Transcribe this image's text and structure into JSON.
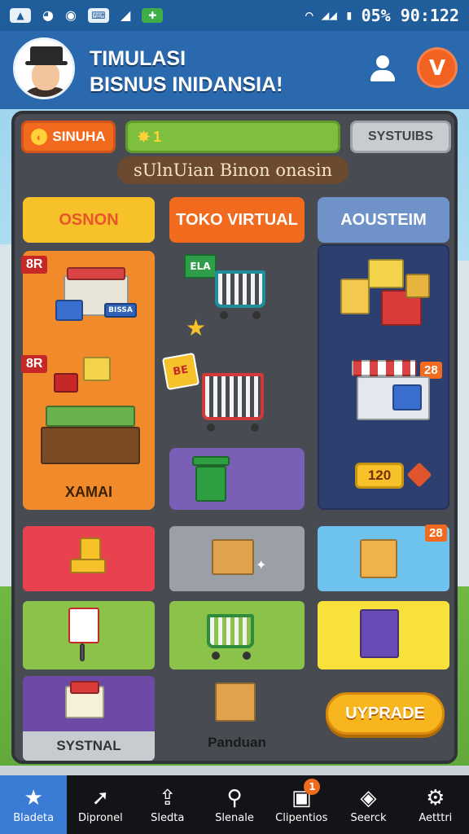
{
  "status_bar": {
    "left_icons": [
      "sim-icon",
      "chrome-icon",
      "whatsapp-icon",
      "keyboard-icon",
      "signal-icon",
      "cast-icon"
    ],
    "right_text": "05% 90:122",
    "battery_icon": "battery-icon",
    "wifi_icon": "wifi-icon"
  },
  "header": {
    "title_line1": "TIMULASI",
    "title_line2": "BISNUS INIDANSIA!",
    "profile_icon": "user-icon",
    "v_button_label": "V"
  },
  "toolbar": {
    "simula_label": "SINUHA",
    "progress_icon": "star-icon",
    "progress_value": "1",
    "systems_label": "SYSTUIBS"
  },
  "banner": "sUlnUian Binon onasin",
  "columns": {
    "left": "OSNON",
    "middle": "TOKO VIRTUAL",
    "right": "AOUSTEIM"
  },
  "left_panel": {
    "badge_top": "8R",
    "badge_mid": "8R",
    "caption": "XAMAI",
    "store_sign": "BISSA"
  },
  "middle_panel": {
    "sign_text": "ELA",
    "tag_text": "BE"
  },
  "right_panel": {
    "badge": "28",
    "price": "120"
  },
  "tiles": {
    "sky_badge": "28",
    "sys_label": "SYSTNAL",
    "panduan_label": "Panduan",
    "upgrade_label": "UYPRADE"
  },
  "colors": {
    "accent_orange": "#f26a1e",
    "header_blue": "#2a69ad",
    "board_gray": "#484c52",
    "nav_active": "#3a7bd5"
  },
  "bottom_nav": [
    {
      "label": "Bladeta",
      "icon": "star-icon",
      "active": true
    },
    {
      "label": "Dipronel",
      "icon": "cursor-icon",
      "active": false
    },
    {
      "label": "Sledta",
      "icon": "share-icon",
      "active": false
    },
    {
      "label": "Slenale",
      "icon": "map-pin-icon",
      "active": false
    },
    {
      "label": "Clipentios",
      "icon": "clipboard-icon",
      "active": false,
      "badge": "1"
    },
    {
      "label": "Seerck",
      "icon": "compass-icon",
      "active": false
    },
    {
      "label": "Aetttri",
      "icon": "gear-icon",
      "active": false
    }
  ]
}
